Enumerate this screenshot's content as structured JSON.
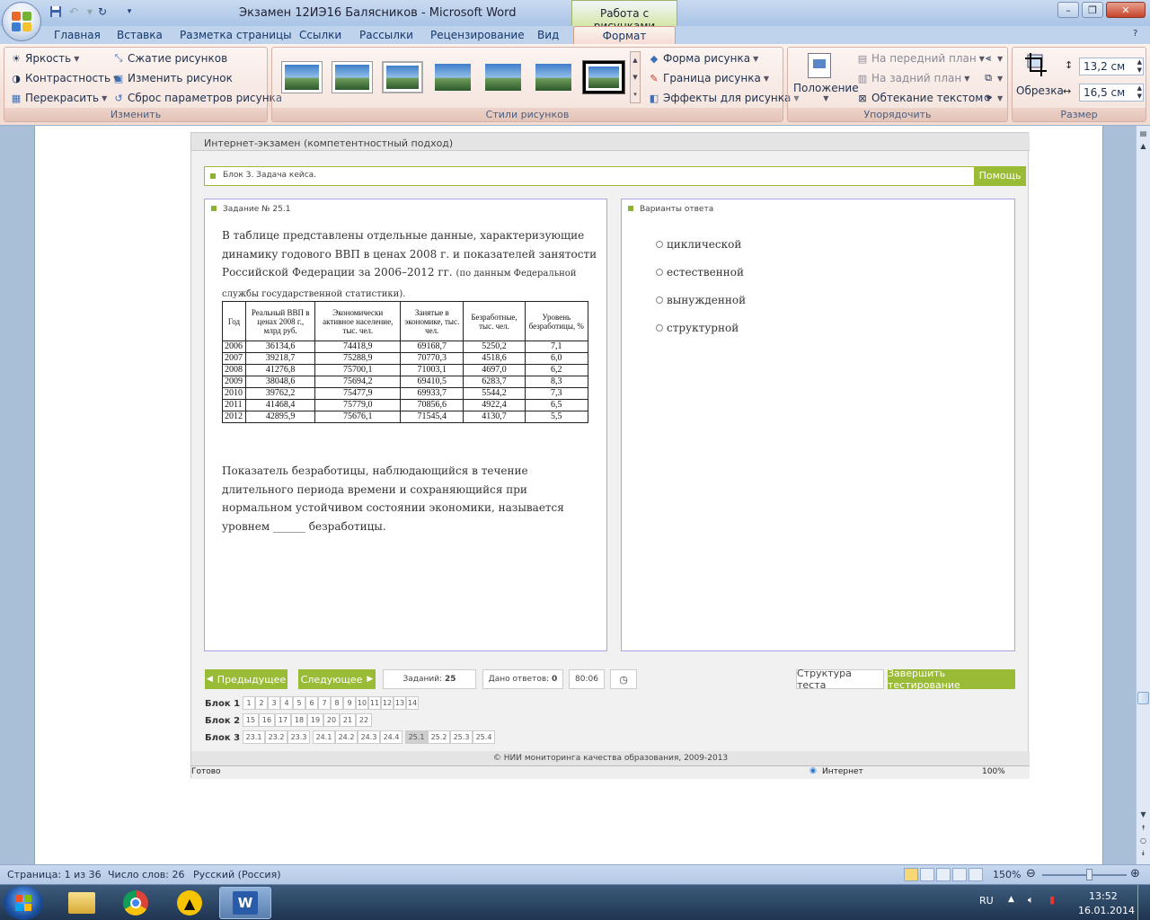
{
  "window": {
    "title": "Экзамен 12ИЭ16 Баляcников  -  Microsoft Word",
    "context_title": "Работа с рисунками"
  },
  "tabs": [
    "Главная",
    "Вставка",
    "Разметка страницы",
    "Ссылки",
    "Рассылки",
    "Рецензирование",
    "Вид",
    "Формат"
  ],
  "ribbon": {
    "adjust": {
      "brightness": "Яркость",
      "contrast": "Контрастность",
      "recolor": "Перекрасить",
      "compress": "Сжатие рисунков",
      "change": "Изменить рисунок",
      "reset": "Сброс параметров рисунка",
      "label": "Изменить"
    },
    "styles": {
      "label": "Стили рисунков",
      "shape": "Форма рисунка",
      "border": "Граница рисунка",
      "effects": "Эффекты для рисунка"
    },
    "arrange": {
      "label": "Упорядочить",
      "position": "Положение",
      "front": "На передний план",
      "back": "На задний план",
      "wrap": "Обтекание текстом"
    },
    "size": {
      "label": "Размер",
      "crop": "Обрезка",
      "height": "13,2 см",
      "width": "16,5 см"
    }
  },
  "exam": {
    "header": "Интернет-экзамен (компетентностный подход)",
    "block": "Блок 3. Задача кейса.",
    "help": "Помощь",
    "task_title": "Задание № 25.1",
    "answers_title": "Варианты ответа",
    "task_text_main": "В таблице представлены отдельные данные, характеризующие динамику годового ВВП в ценах 2008 г. и показателей занятости Российской Федерации за 2006–2012 гг.",
    "task_text_small": "(по данным Федеральной службы государственной статистики).",
    "table": {
      "headers": [
        "Год",
        "Реальный ВВП в ценах 2008 г., млрд руб.",
        "Экономически активное население, тыс. чел.",
        "Занятые в экономике, тыс. чел.",
        "Безработные, тыс. чел.",
        "Уровень безработицы, %"
      ],
      "rows": [
        [
          "2006",
          "36134,6",
          "74418,9",
          "69168,7",
          "5250,2",
          "7,1"
        ],
        [
          "2007",
          "39218,7",
          "75288,9",
          "70770,3",
          "4518,6",
          "6,0"
        ],
        [
          "2008",
          "41276,8",
          "75700,1",
          "71003,1",
          "4697,0",
          "6,2"
        ],
        [
          "2009",
          "38048,6",
          "75694,2",
          "69410,5",
          "6283,7",
          "8,3"
        ],
        [
          "2010",
          "39762,2",
          "75477,9",
          "69933,7",
          "5544,2",
          "7,3"
        ],
        [
          "2011",
          "41468,4",
          "75779,0",
          "70856,6",
          "4922,4",
          "6,5"
        ],
        [
          "2012",
          "42895,9",
          "75676,1",
          "71545,4",
          "4130,7",
          "5,5"
        ]
      ]
    },
    "question": "Показатель безработицы, наблюдающийся в течение длительного периода времени и сохраняющийся при нормальном устойчивом состоянии экономики, называется уровнем ______ безработицы.",
    "options": [
      "циклической",
      "естественной",
      "вынужденной",
      "структурной"
    ],
    "nav": {
      "prev": "Предыдущее",
      "next": "Следующее",
      "tasks_label": "Заданий:",
      "tasks_value": "25",
      "answers_label": "Дано ответов:",
      "answers_value": "0",
      "timer": "80:06",
      "structure": "Структура теста",
      "finish": "Завершить тестирование"
    },
    "blocks": [
      {
        "label": "Блок 1",
        "cells": [
          "1",
          "2",
          "3",
          "4",
          "5",
          "6",
          "7",
          "8",
          "9",
          "10",
          "11",
          "12",
          "13",
          "14"
        ]
      },
      {
        "label": "Блок 2",
        "cells": [
          "15",
          "16",
          "17",
          "18",
          "19",
          "20",
          "21",
          "22"
        ]
      },
      {
        "label": "Блок 3",
        "cells": [
          "23.1",
          "23.2",
          "23.3",
          "24.1",
          "24.2",
          "24.3",
          "24.4",
          "25.1",
          "25.2",
          "25.3",
          "25.4"
        ]
      }
    ],
    "copyright": "© НИИ мониторинга качества образования, 2009-2013",
    "ie_status": "Готово",
    "ie_zone": "Интернет",
    "ie_zoom": "100%"
  },
  "status": {
    "page": "Страница: 1 из 36",
    "words": "Число слов: 26",
    "lang": "Русский (Россия)",
    "zoom": "150%"
  },
  "taskbar": {
    "lang": "RU",
    "time": "13:52",
    "date": "16.01.2014"
  },
  "colors": {
    "accent_green": "#9abb35",
    "ribbon_format": "#f3dfd7",
    "title_blue": "#a9c4e6"
  }
}
